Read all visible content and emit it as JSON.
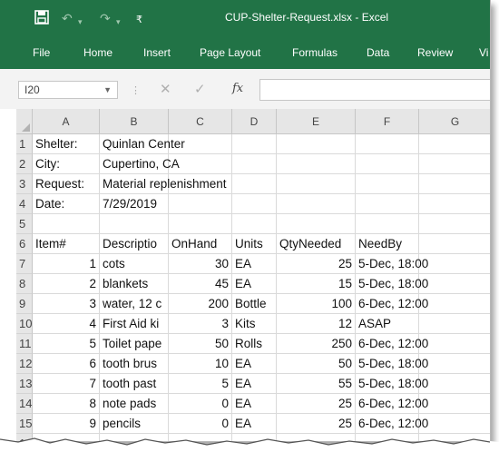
{
  "window": {
    "title": "CUP-Shelter-Request.xlsx  -  Excel"
  },
  "quick_access": {
    "save_icon": "save-icon",
    "undo_icon": "undo-icon",
    "redo_icon": "redo-icon",
    "customize_icon": "customize-quick-access-icon"
  },
  "ribbon": {
    "tabs": [
      "File",
      "Home",
      "Insert",
      "Page Layout",
      "Formulas",
      "Data",
      "Review",
      "Vi"
    ]
  },
  "formula_bar": {
    "name_box": "I20",
    "fx_label": "fx",
    "formula": ""
  },
  "grid": {
    "columns": [
      "A",
      "B",
      "C",
      "D",
      "E",
      "F",
      "G"
    ],
    "rows": [
      {
        "num": "1",
        "cells": [
          "Shelter:",
          "Quinlan Center",
          "",
          "",
          "",
          "",
          ""
        ]
      },
      {
        "num": "2",
        "cells": [
          "City:",
          "Cupertino, CA",
          "",
          "",
          "",
          "",
          ""
        ]
      },
      {
        "num": "3",
        "cells": [
          "Request:",
          "Material replenishment",
          "",
          "",
          "",
          "",
          ""
        ]
      },
      {
        "num": "4",
        "cells": [
          "Date:",
          "7/29/2019",
          "",
          "",
          "",
          "",
          ""
        ]
      },
      {
        "num": "5",
        "cells": [
          "",
          "",
          "",
          "",
          "",
          "",
          ""
        ]
      },
      {
        "num": "6",
        "cells": [
          "Item#",
          "Descriptio",
          "OnHand",
          "Units",
          "QtyNeeded",
          "NeedBy",
          ""
        ]
      },
      {
        "num": "7",
        "cells": [
          "1",
          "cots",
          "30",
          "EA",
          "25",
          "5-Dec, 18:00",
          ""
        ]
      },
      {
        "num": "8",
        "cells": [
          "2",
          "blankets",
          "45",
          "EA",
          "15",
          "5-Dec, 18:00",
          ""
        ]
      },
      {
        "num": "9",
        "cells": [
          "3",
          "water, 12 c",
          "200",
          "Bottle",
          "100",
          "6-Dec, 12:00",
          ""
        ]
      },
      {
        "num": "10",
        "cells": [
          "4",
          "First Aid ki",
          "3",
          "Kits",
          "12",
          "ASAP",
          ""
        ]
      },
      {
        "num": "11",
        "cells": [
          "5",
          "Toilet pape",
          "50",
          "Rolls",
          "250",
          "6-Dec, 12:00",
          ""
        ]
      },
      {
        "num": "12",
        "cells": [
          "6",
          "tooth brus",
          "10",
          "EA",
          "50",
          "5-Dec, 18:00",
          ""
        ]
      },
      {
        "num": "13",
        "cells": [
          "7",
          "tooth past",
          "5",
          "EA",
          "55",
          "5-Dec, 18:00",
          ""
        ]
      },
      {
        "num": "14",
        "cells": [
          "8",
          "note pads",
          "0",
          "EA",
          "25",
          "6-Dec, 12:00",
          ""
        ]
      },
      {
        "num": "15",
        "cells": [
          "9",
          "pencils",
          "0",
          "EA",
          "25",
          "6-Dec, 12:00",
          ""
        ]
      },
      {
        "num": "16",
        "cells": [
          "",
          "",
          "",
          "",
          "",
          "",
          ""
        ]
      }
    ]
  },
  "colors": {
    "excel_green": "#217346",
    "header_gray": "#e6e6e6",
    "gridline": "#dadada"
  }
}
